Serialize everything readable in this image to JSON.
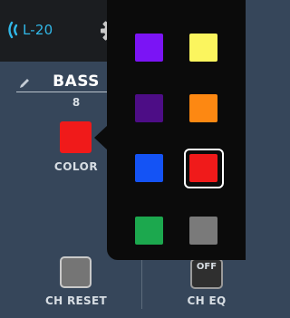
{
  "header": {
    "device_name": "L-20"
  },
  "channel": {
    "name": "BASS",
    "number": "8",
    "color_label": "COLOR",
    "current_color": "#f01a1a"
  },
  "buttons": {
    "ch_reset_label": "CH RESET",
    "ch_eq_label": "CH EQ",
    "ch_eq_state": "OFF"
  },
  "color_picker": {
    "selected": "red",
    "options": [
      {
        "name": "purple",
        "hex": "#7b14f5"
      },
      {
        "name": "yellow",
        "hex": "#fbf55e"
      },
      {
        "name": "dark-purple",
        "hex": "#4d0d86"
      },
      {
        "name": "orange",
        "hex": "#fd8812"
      },
      {
        "name": "blue",
        "hex": "#1453f5"
      },
      {
        "name": "red",
        "hex": "#f01a1a"
      },
      {
        "name": "green",
        "hex": "#1ca84e"
      },
      {
        "name": "gray",
        "hex": "#7a7a7a"
      }
    ]
  }
}
